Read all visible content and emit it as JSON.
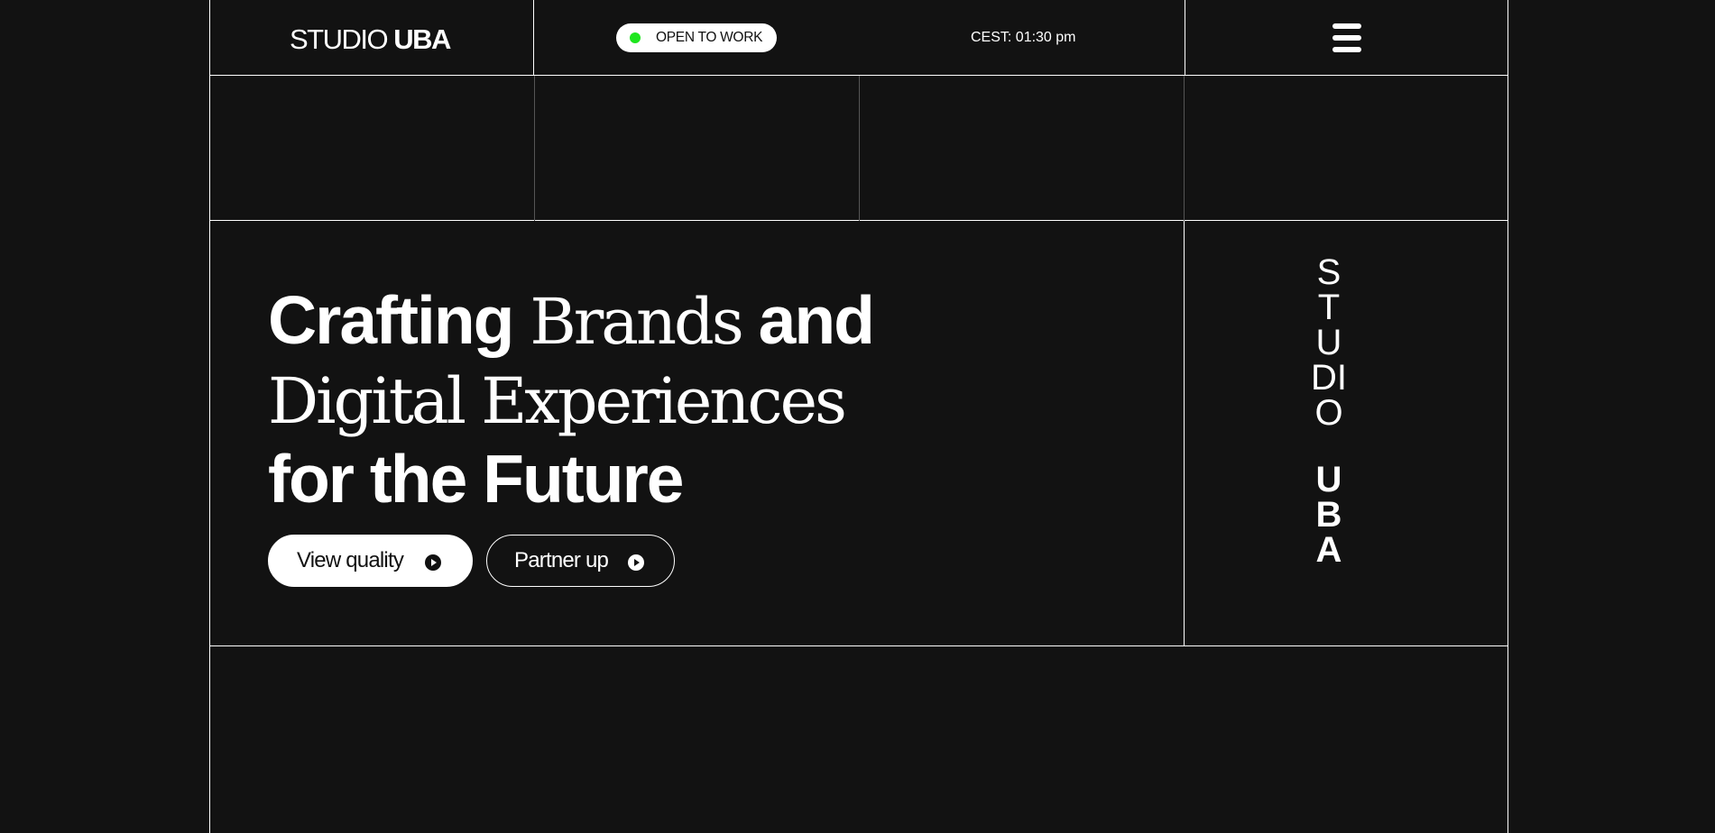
{
  "header": {
    "logo_light": "STUDIO ",
    "logo_bold": "UBA",
    "status_label": "OPEN TO WORK",
    "status_dot_color": "#1ee61e",
    "clock": "CEST: 01:30 pm",
    "menu_icon": "hamburger-menu-icon"
  },
  "hero": {
    "headline": {
      "line1_sans": "Crafting",
      "line1_serif": "Brands",
      "line1_sans2": "and",
      "line2_serif": "Digital Experiences",
      "line3_sans": "for the Future"
    },
    "buttons": [
      {
        "label": "View quality",
        "icon": "play-circle-icon"
      },
      {
        "label": "Partner up",
        "icon": "play-circle-icon"
      }
    ],
    "vertical_brand": {
      "light": "STUDIO",
      "bold": "UBA"
    }
  },
  "colors": {
    "background": "#121212",
    "foreground": "#ffffff",
    "status_green": "#1ee61e"
  }
}
